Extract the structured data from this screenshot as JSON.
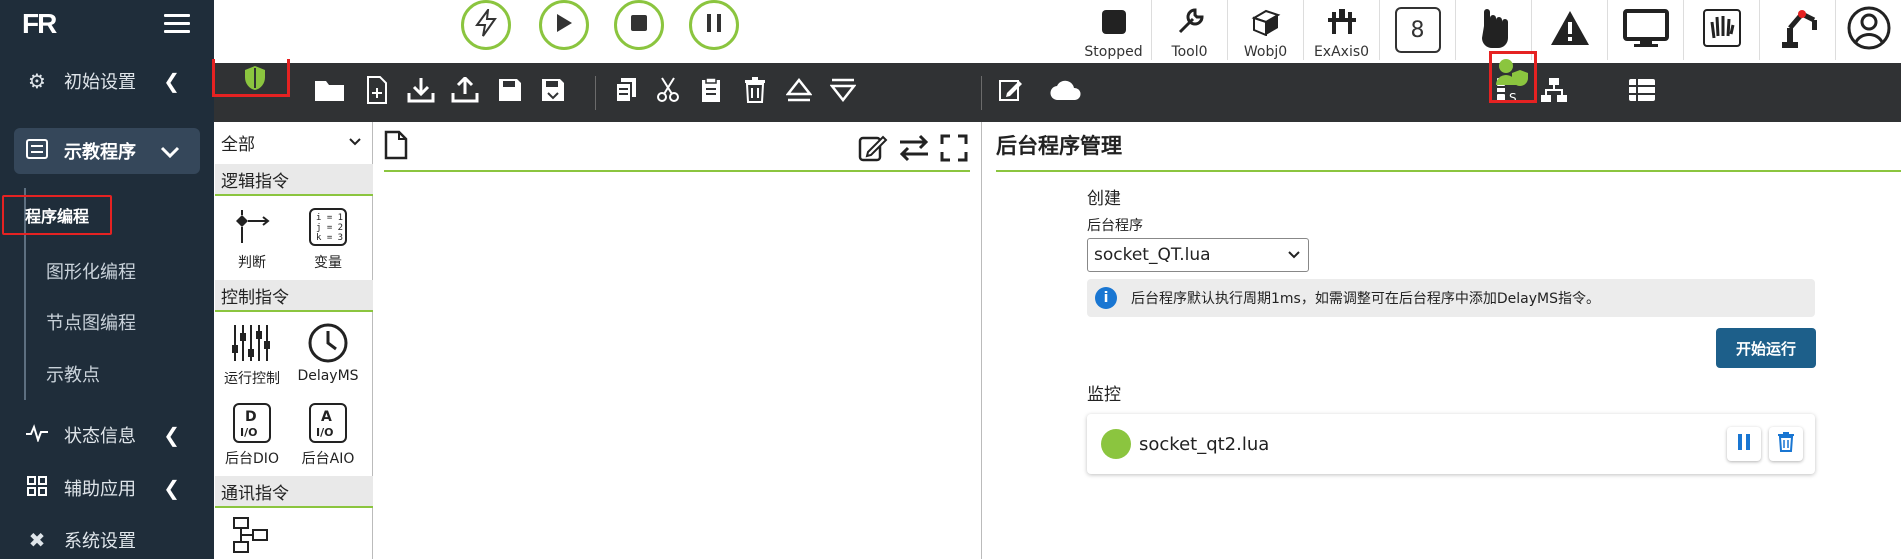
{
  "sidebar": {
    "logo": "FR",
    "items": [
      {
        "label": "初始设置",
        "icon": "gear-icon"
      },
      {
        "label": "示教程序",
        "icon": "list-icon"
      },
      {
        "label": "状态信息",
        "icon": "pulse-icon"
      },
      {
        "label": "辅助应用",
        "icon": "grid-icon"
      },
      {
        "label": "系统设置",
        "icon": "tools-icon"
      }
    ],
    "sub_items": [
      {
        "label": "程序编程"
      },
      {
        "label": "图形化编程"
      },
      {
        "label": "节点图编程"
      },
      {
        "label": "示教点"
      }
    ]
  },
  "topbar": {
    "controls": [
      "lightning-icon",
      "play-icon",
      "stop-icon",
      "pause-icon"
    ],
    "status": [
      {
        "label": "Stopped",
        "icon": "stop-square-icon"
      },
      {
        "label": "Tool0",
        "icon": "wrench-icon"
      },
      {
        "label": "Wobj0",
        "icon": "cube-icon"
      },
      {
        "label": "ExAxis0",
        "icon": "axis-icon"
      }
    ],
    "speed_value": "8"
  },
  "instructions": {
    "filter": "全部",
    "categories": [
      {
        "label": "逻辑指令",
        "items": [
          {
            "label": "判断"
          },
          {
            "label": "变量"
          }
        ]
      },
      {
        "label": "控制指令",
        "items": [
          {
            "label": "运行控制"
          },
          {
            "label": "DelayMS"
          },
          {
            "label": "后台DIO"
          },
          {
            "label": "后台AIO"
          }
        ]
      },
      {
        "label": "通讯指令"
      }
    ]
  },
  "right_panel": {
    "title": "后台程序管理",
    "create_label": "创建",
    "program_label": "后台程序",
    "program_selected": "socket_QT.lua",
    "info_text": "后台程序默认执行周期1ms，如需调整可在后台程序中添加DelayMS指令。",
    "start_button": "开始运行",
    "monitor_label": "监控",
    "monitor_item": "socket_qt2.lua"
  },
  "colors": {
    "accent_green": "#8bc53f",
    "sidebar_bg": "#1f2d3a",
    "toolbar_bg": "#303234",
    "highlight_red": "#e52222",
    "primary_button": "#1d5f8a"
  }
}
